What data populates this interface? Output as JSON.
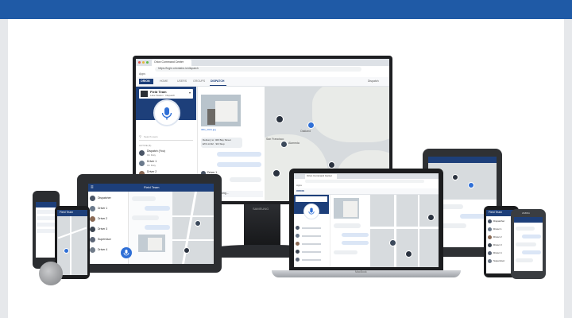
{
  "colors": {
    "header_blue": "#1f5aa6",
    "app_navy": "#1d3f7a",
    "map_grey": "#d7dbde",
    "bubble_blue": "#dbe6f6",
    "bubble_grey": "#eceff2",
    "accent_blue": "#2f6fd6"
  },
  "monitor": {
    "browser_tab": "Orion Command Center",
    "address": "https://login.orionlabs.io/dispatch",
    "bookmark": "Apps",
    "brand": "ORION",
    "nav": [
      "HOME",
      "USERS",
      "GROUPS",
      "DISPATCH"
    ],
    "active_nav": "DISPATCH",
    "user_menu": "Dispatch",
    "group_title": "Field Team",
    "group_subtitle": "Lake Station · Dispatch",
    "search_placeholder": "Search users",
    "section_active": "ACTIVE (5)",
    "users": [
      {
        "name": "Dispatch (You)",
        "status": "On Duty"
      },
      {
        "name": "Driver 1",
        "status": "On Duty"
      },
      {
        "name": "Driver 2",
        "status": "En Route"
      }
    ],
    "attachment": "IMG_2041.jpg",
    "messages": [
      "Delivery to: 400 Bay Street",
      "ETA 14:32 · 9th Stop"
    ],
    "sender": "Driver 1",
    "speaking": "Driver 1 is speaking...",
    "map_cities": [
      "Oakland",
      "Alameda",
      "San Francisco"
    ],
    "stand_brand": "SAMSUNG"
  },
  "laptop": {
    "browser_tab": "Orion Command Center",
    "bookmark": "Apps",
    "brand": "ORION",
    "keyboard_brand": "MacBook"
  },
  "tablet": {
    "header": "Field Team",
    "items": [
      "Dispatcher",
      "Driver 1",
      "Driver 2",
      "Driver 3",
      "Supervisor",
      "Driver 4"
    ]
  },
  "phones": {
    "left_header": "Field Team",
    "right_header": "Field Team",
    "right_brand": "ZEBRA",
    "contacts": [
      "Dispatcher",
      "Driver 1",
      "Driver 2",
      "Driver 3",
      "Driver 4",
      "Supervisor"
    ]
  },
  "icons": [
    "mic-icon",
    "search-icon",
    "map-pin-icon",
    "menu-icon",
    "chevron-down-icon"
  ]
}
